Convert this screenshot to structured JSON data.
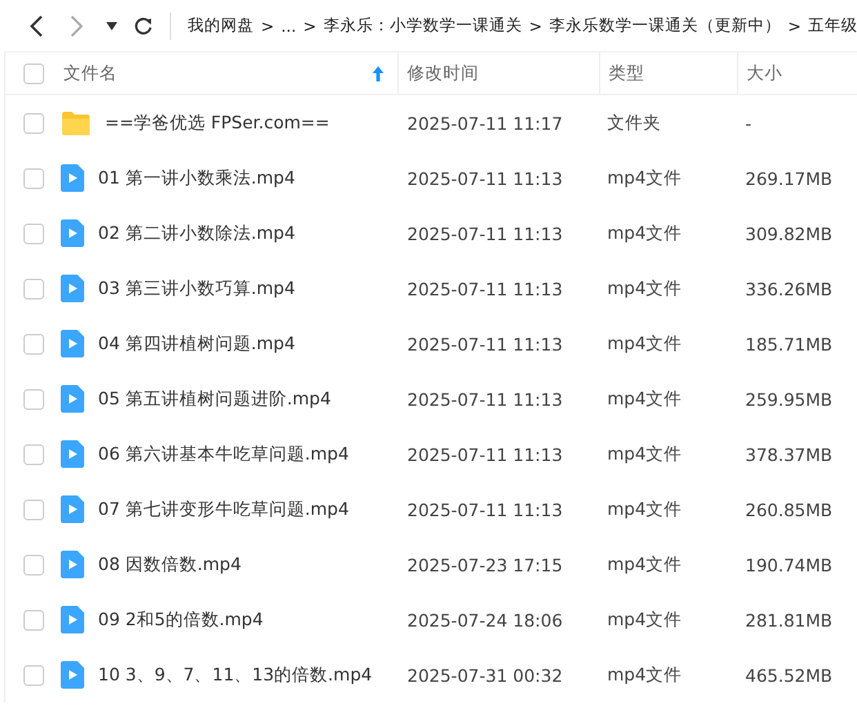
{
  "toolbar": {
    "breadcrumbs": [
      "我的网盘",
      "...",
      "李永乐：小学数学一课通关",
      "李永乐数学一课通关（更新中）",
      "五年级"
    ],
    "separator": ">"
  },
  "table": {
    "all_checked": false,
    "columns": [
      {
        "label": "文件名",
        "sorted": true
      },
      {
        "label": "修改时间",
        "sorted": false
      },
      {
        "label": "类型",
        "sorted": false
      },
      {
        "label": "大小",
        "sorted": false
      }
    ],
    "rows": [
      {
        "kind": "folder",
        "name": "==学爸优选 FPSer.com==",
        "modified": "2025-07-11 11:17",
        "type": "文件夹",
        "size": "-",
        "checked": false
      },
      {
        "kind": "video",
        "name": "01 第一讲小数乘法.mp4",
        "modified": "2025-07-11 11:13",
        "type": "mp4文件",
        "size": "269.17MB",
        "checked": false
      },
      {
        "kind": "video",
        "name": "02 第二讲小数除法.mp4",
        "modified": "2025-07-11 11:13",
        "type": "mp4文件",
        "size": "309.82MB",
        "checked": false
      },
      {
        "kind": "video",
        "name": "03 第三讲小数巧算.mp4",
        "modified": "2025-07-11 11:13",
        "type": "mp4文件",
        "size": "336.26MB",
        "checked": false
      },
      {
        "kind": "video",
        "name": "04 第四讲植树问题.mp4",
        "modified": "2025-07-11 11:13",
        "type": "mp4文件",
        "size": "185.71MB",
        "checked": false
      },
      {
        "kind": "video",
        "name": "05 第五讲植树问题进阶.mp4",
        "modified": "2025-07-11 11:13",
        "type": "mp4文件",
        "size": "259.95MB",
        "checked": false
      },
      {
        "kind": "video",
        "name": "06 第六讲基本牛吃草问题.mp4",
        "modified": "2025-07-11 11:13",
        "type": "mp4文件",
        "size": "378.37MB",
        "checked": false
      },
      {
        "kind": "video",
        "name": "07 第七讲变形牛吃草问题.mp4",
        "modified": "2025-07-11 11:13",
        "type": "mp4文件",
        "size": "260.85MB",
        "checked": false
      },
      {
        "kind": "video",
        "name": "08 因数倍数.mp4",
        "modified": "2025-07-23 17:15",
        "type": "mp4文件",
        "size": "190.74MB",
        "checked": false
      },
      {
        "kind": "video",
        "name": "09 2和5的倍数.mp4",
        "modified": "2025-07-24 18:06",
        "type": "mp4文件",
        "size": "281.81MB",
        "checked": false
      },
      {
        "kind": "video",
        "name": "10 3、9、7、11、13的倍数.mp4",
        "modified": "2025-07-31 00:32",
        "type": "mp4文件",
        "size": "465.52MB",
        "checked": false
      }
    ]
  }
}
